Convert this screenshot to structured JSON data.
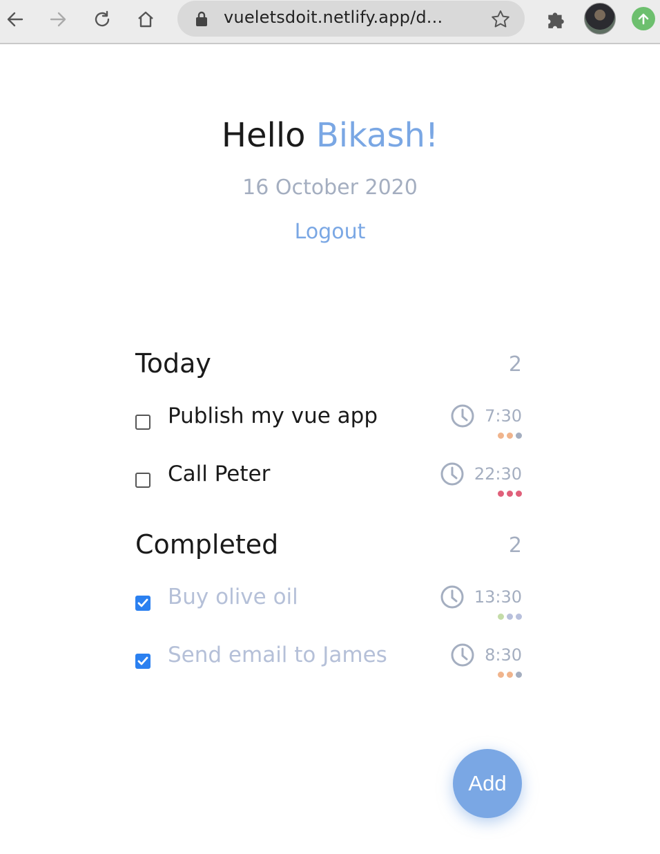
{
  "browser": {
    "url": "vueletsdoit.netlify.app/d..."
  },
  "header": {
    "greeting": "Hello",
    "name": "Bikash!",
    "date": "16 October 2020",
    "logout_label": "Logout"
  },
  "sections": [
    {
      "title": "Today",
      "count": "2",
      "tasks": [
        {
          "label": "Publish my vue app",
          "time": "7:30",
          "done": false,
          "priority_colors": [
            "#f0b48c",
            "#f0b48c",
            "#a4aec0"
          ]
        },
        {
          "label": "Call Peter",
          "time": "22:30",
          "done": false,
          "priority_colors": [
            "#e0607a",
            "#e0607a",
            "#e0607a"
          ]
        }
      ]
    },
    {
      "title": "Completed",
      "count": "2",
      "tasks": [
        {
          "label": "Buy olive oil",
          "time": "13:30",
          "done": true,
          "priority_colors": [
            "#c4dca8",
            "#b8c0dc",
            "#b8c0dc"
          ]
        },
        {
          "label": "Send email to James",
          "time": "8:30",
          "done": true,
          "priority_colors": [
            "#f0b48c",
            "#f0b48c",
            "#a4aec0"
          ]
        }
      ]
    }
  ],
  "add_label": "Add",
  "icons": {
    "back": "arrow-left-icon",
    "forward": "arrow-right-icon",
    "reload": "reload-icon",
    "home": "home-icon",
    "lock": "lock-icon",
    "bookmark": "star-icon",
    "extensions": "puzzle-icon",
    "update": "arrow-up-icon",
    "clock": "clock-icon"
  },
  "colors": {
    "accent": "#7aa7e4",
    "muted": "#a4aec0",
    "checkbox_checked": "#2b80f0"
  }
}
